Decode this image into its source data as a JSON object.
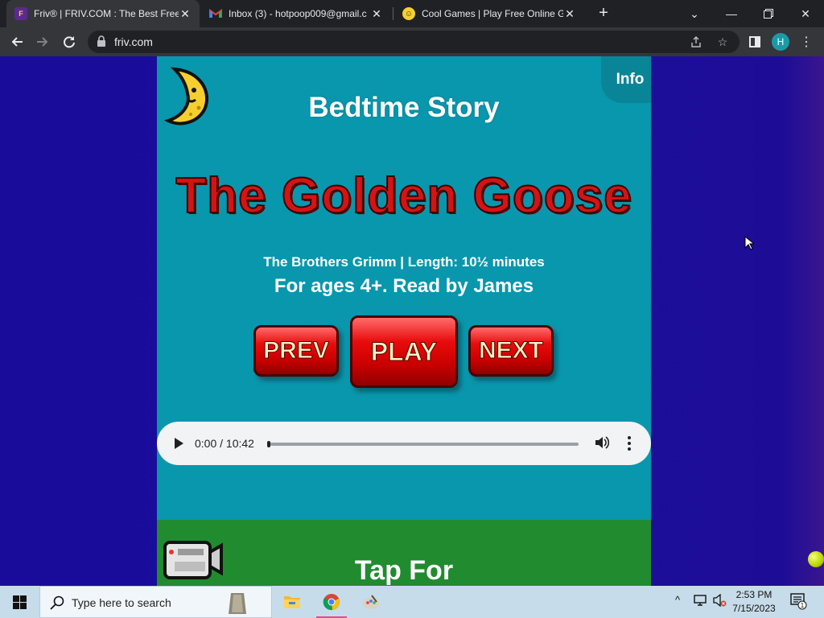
{
  "browser": {
    "tabs": [
      {
        "title": "Friv® | FRIV.COM : The Best Free",
        "favicon": "friv-logo",
        "active": true
      },
      {
        "title": "Inbox (3) - hotpoop009@gmail.c",
        "favicon": "gmail-logo",
        "active": false
      },
      {
        "title": "Cool Games | Play Free Online Ga",
        "favicon": "smiley-face",
        "active": false
      }
    ],
    "url": "friv.com",
    "profile_initial": "H"
  },
  "page": {
    "info_label": "Info",
    "heading": "Bedtime Story",
    "story_title": "The Golden Goose",
    "meta": "The Brothers Grimm | Length: 10½ minutes",
    "ages": "For ages 4+. Read by James",
    "buttons": {
      "prev": "PREV",
      "play": "PLAY",
      "next": "NEXT"
    },
    "audio": {
      "time": "0:00 / 10:42",
      "progress": 0.0
    },
    "next_section": "Tap For"
  },
  "taskbar": {
    "search_placeholder": "Type here to search",
    "time": "2:53 PM",
    "date": "7/15/2023",
    "notification_count": "1"
  },
  "colors": {
    "page_bg": "#0997ad",
    "title_red": "#d31414",
    "green_section": "#218b2f",
    "outer_bg": "#1a0c9a"
  }
}
